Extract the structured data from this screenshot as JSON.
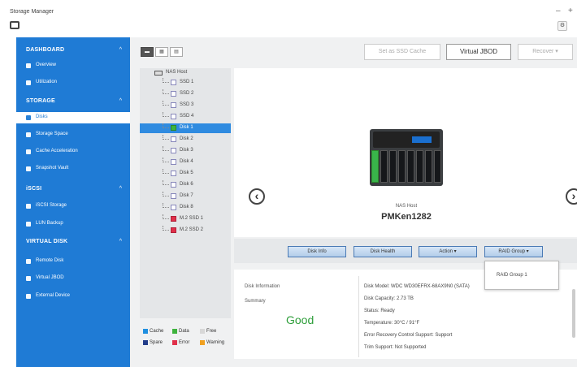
{
  "app": {
    "title": "Storage Manager",
    "minimize": "–",
    "maximize": "+"
  },
  "toolbar": {
    "view_buttons": [
      "▬",
      "▦",
      "▤"
    ],
    "set_ssd_cache": "Set as SSD Cache",
    "virtual_jbod": "Virtual JBOD",
    "recover": "Recover ▾"
  },
  "sidebar": {
    "dashboard": "DASHBOARD",
    "dashboard_items": [
      "Overview",
      "Utilization"
    ],
    "storage": "STORAGE",
    "storage_items": [
      "Disks",
      "Storage Space",
      "Cache Acceleration",
      "Snapshot Vault"
    ],
    "iscsi": "iSCSI",
    "iscsi_items": [
      "iSCSI Storage",
      "LUN Backup"
    ],
    "virtual_disk": "VIRTUAL DISK",
    "virtual_items": [
      "Remote Disk",
      "Virtual JBOD",
      "External Device"
    ],
    "caret": "^"
  },
  "tree": {
    "root": "NAS Host",
    "items": [
      {
        "label": "SSD 1",
        "color": "none"
      },
      {
        "label": "SSD 2",
        "color": "none"
      },
      {
        "label": "SSD 3",
        "color": "none"
      },
      {
        "label": "SSD 4",
        "color": "none"
      },
      {
        "label": "Disk 1",
        "color": "green",
        "selected": true
      },
      {
        "label": "Disk 2",
        "color": "none"
      },
      {
        "label": "Disk 3",
        "color": "none"
      },
      {
        "label": "Disk 4",
        "color": "none"
      },
      {
        "label": "Disk 5",
        "color": "none"
      },
      {
        "label": "Disk 6",
        "color": "none"
      },
      {
        "label": "Disk 7",
        "color": "none"
      },
      {
        "label": "Disk 8",
        "color": "none"
      },
      {
        "label": "M.2 SSD 1",
        "color": "red"
      },
      {
        "label": "M.2 SSD 2",
        "color": "red"
      }
    ]
  },
  "legend": [
    {
      "label": "Cache",
      "color": "#1f8fe0"
    },
    {
      "label": "Data",
      "color": "#3db33d"
    },
    {
      "label": "Free",
      "color": "#d8d8d8"
    },
    {
      "label": "Spare",
      "color": "#223d8a"
    },
    {
      "label": "Error",
      "color": "#e0304a"
    },
    {
      "label": "Warning",
      "color": "#f0a020"
    }
  ],
  "device": {
    "label": "NAS Host",
    "name": "PMKen1282",
    "prev": "‹",
    "next": "›"
  },
  "actions": {
    "disk_info": "Disk Info",
    "disk_health": "Disk Health",
    "action": "Action ▾",
    "raid_group": "RAID Group ▾",
    "raid_menu_item": "RAID Group 1"
  },
  "info": {
    "title": "Disk Information",
    "summary_label": "Summary",
    "status": "Good",
    "details": [
      "Disk Model: WDC WD30EFRX-68AX9N0 (SATA)",
      "Disk Capacity: 2.73 TB",
      "Status: Ready",
      "Temperature: 30°C / 91°F",
      "Error Recovery Control Support: Support",
      "Trim Support: Not Supported"
    ]
  }
}
